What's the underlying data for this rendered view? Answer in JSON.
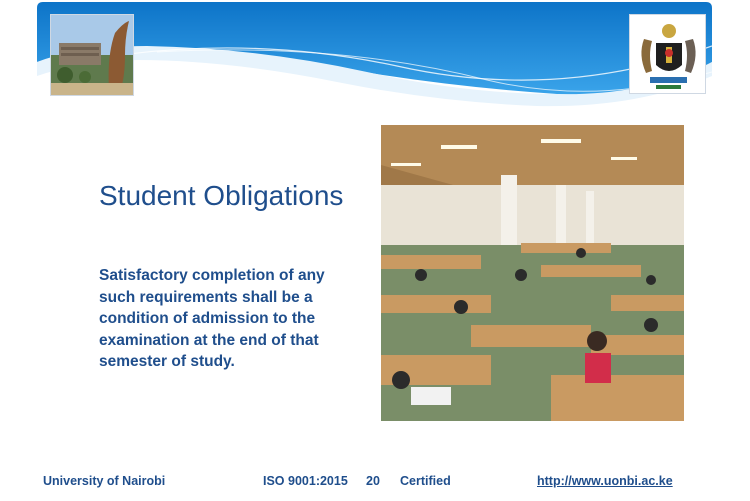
{
  "slide": {
    "title": "Student Obligations",
    "body": "Satisfactory completion of any such requirements shall be a condition of admission to the examination at the end of that semester of study."
  },
  "footer": {
    "institution": "University of Nairobi",
    "iso": "ISO 9001:2015",
    "page_number": "20",
    "certified": "Certified",
    "url": "http://www.uonbi.ac.ke"
  },
  "colors": {
    "title_text": "#1f4e8c",
    "header_blue": "#1b84d4",
    "header_light": "#d8ecfa"
  },
  "images": {
    "left_header": "campus-building-photo",
    "right_header": "university-crest",
    "main": "library-reading-hall-photo"
  }
}
